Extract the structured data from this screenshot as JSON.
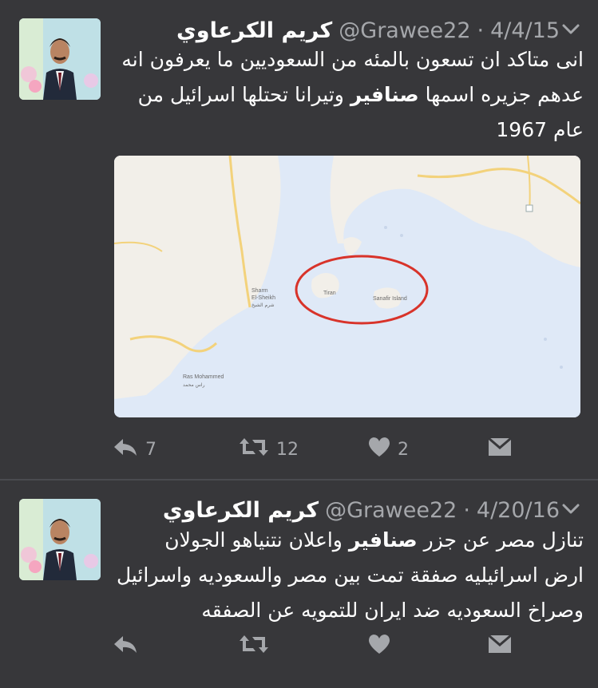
{
  "tweets": [
    {
      "name": "كريم الكرعاوي",
      "handle": "@Grawee22",
      "dot": "·",
      "date": "4/4/15",
      "lines": [
        {
          "before": "",
          "bold": "",
          "after": "انى متاكد ان تسعون بالمئه من السعوديين ما يعرفون انه"
        },
        {
          "before": "عدهم جزيره اسمها ",
          "bold": "صنافير",
          "after": " وتيرانا تحتلها اسرائيل من"
        },
        {
          "before": "",
          "bold": "",
          "after": "عام 1967"
        }
      ],
      "reply_count": "7",
      "retweet_count": "12",
      "like_count": "2",
      "map": {
        "labels": {
          "tiran": "Tiran",
          "sanafir": "Sanafir Island",
          "sharm_en": "Sharm",
          "sharm_en2": "El-Sheikh",
          "sharm_ar": "شرم الشيخ",
          "ras_en": "Ras Mohammed",
          "ras_ar": "راس محمد"
        },
        "colors": {
          "sea": "#dfe9f7",
          "land": "#f2efe9",
          "circle": "#d8332a",
          "road": "#f3d27b"
        }
      }
    },
    {
      "name": "كريم الكرعاوي",
      "handle": "@Grawee22",
      "dot": "·",
      "date": "4/20/16",
      "lines": [
        {
          "before": "تنازل مصر عن جزر ",
          "bold": "صنافير",
          "after": " واعلان نتنياهو الجولان"
        },
        {
          "before": "",
          "bold": "",
          "after": "ارض اسرائيليه صفقة تمت بين مصر والسعوديه واسرائيل"
        },
        {
          "before": "",
          "bold": "",
          "after": "وصراخ السعوديه ضد ايران للتمويه عن الصفقه"
        }
      ]
    }
  ],
  "icons": [
    "avatar",
    "chevron-down-icon",
    "reply-icon",
    "retweet-icon",
    "like-icon",
    "direct-message-icon"
  ]
}
